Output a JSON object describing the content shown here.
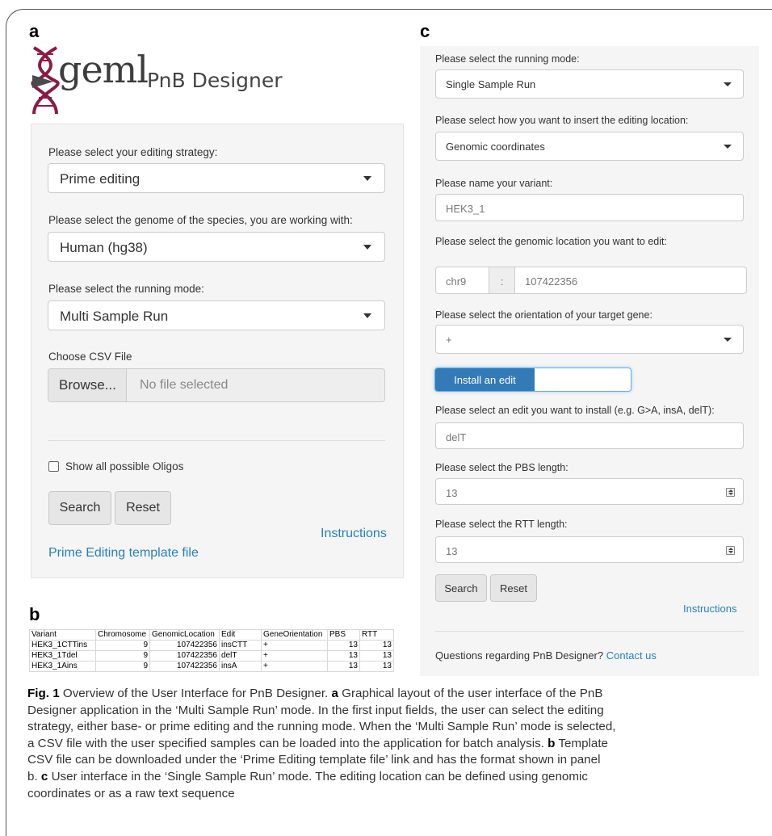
{
  "panels": {
    "a": "a",
    "b": "b",
    "c": "c"
  },
  "panel_a": {
    "logo": {
      "brand": "geml",
      "app_name": "PnB Designer"
    },
    "strategy": {
      "label": "Please select your editing strategy:",
      "value": "Prime editing"
    },
    "genome": {
      "label": "Please select the genome of the species, you are working with:",
      "value": "Human (hg38)"
    },
    "mode": {
      "label": "Please select the running mode:",
      "value": "Multi Sample Run"
    },
    "file": {
      "label": "Choose CSV File",
      "browse": "Browse...",
      "status": "No file selected"
    },
    "show_all": {
      "label": "Show all possible Oligos",
      "checked": false
    },
    "search": "Search",
    "reset": "Reset",
    "instructions": "Instructions",
    "template_link": "Prime Editing template file",
    "link_color": "#2a7fba"
  },
  "panel_b": {
    "headers": [
      "Variant",
      "Chromosome",
      "GenomicLocation",
      "Edit",
      "GeneOrientation",
      "PBS",
      "RTT"
    ],
    "rows": [
      [
        "HEK3_1CTTins",
        "9",
        "107422356",
        "insCTT",
        "+",
        "13",
        "13"
      ],
      [
        "HEK3_1Tdel",
        "9",
        "107422356",
        "delT",
        "+",
        "13",
        "13"
      ],
      [
        "HEK3_1Ains",
        "9",
        "107422356",
        "insA",
        "+",
        "13",
        "13"
      ]
    ]
  },
  "panel_c": {
    "mode": {
      "label": "Please select the running mode:",
      "value": "Single Sample Run"
    },
    "insert": {
      "label": "Please select how you want to insert the editing location:",
      "value": "Genomic coordinates"
    },
    "variant": {
      "label": "Please name your variant:",
      "value": "HEK3_1"
    },
    "location": {
      "label": "Please select the genomic location you want to edit:",
      "chromosome": "chr9",
      "separator": ":",
      "position": "107422356"
    },
    "orientation": {
      "label": "Please select the orientation of your target gene:",
      "value": "+"
    },
    "toggle": {
      "label": "Install an edit",
      "on": true
    },
    "edit": {
      "label": "Please select an edit you want to install (e.g. G>A, insA, delT):",
      "value": "delT"
    },
    "pbs": {
      "label": "Please select the PBS length:",
      "value": "13"
    },
    "rtt": {
      "label": "Please select the RTT length:",
      "value": "13"
    },
    "search": "Search",
    "reset": "Reset",
    "instructions": "Instructions",
    "footer": {
      "question": "Questions regarding PnB Designer?",
      "contact": "Contact us"
    },
    "accent": "#337ab7"
  },
  "caption": {
    "fig": "Fig. 1",
    "lines": [
      [
        {
          "t": "Fig. 1",
          "b": true
        },
        {
          "t": "  Overview of the User Interface for PnB Designer. "
        },
        {
          "t": "a",
          "b": true
        },
        {
          "t": " Graphical layout of the user interface of the PnB"
        }
      ],
      [
        {
          "t": "Designer application in the ‘Multi Sample Run’ mode. In the first input fields, the user can select the editing"
        }
      ],
      [
        {
          "t": "strategy, either base- or prime editing and the running mode. When the ‘Multi Sample Run’ mode is selected,"
        }
      ],
      [
        {
          "t": "a CSV file with the user specified samples can be loaded into the application for batch analysis. "
        },
        {
          "t": "b",
          "b": true
        },
        {
          "t": " Template"
        }
      ],
      [
        {
          "t": "CSV file can be downloaded under the ‘Prime Editing template file’ link and has the format shown in panel"
        }
      ],
      [
        {
          "t": "b. "
        },
        {
          "t": "c",
          "b": true
        },
        {
          "t": " User interface in the ‘Single Sample Run’ mode. The editing location can be defined using genomic"
        }
      ],
      [
        {
          "t": "coordinates or as a raw text sequence"
        }
      ]
    ]
  }
}
